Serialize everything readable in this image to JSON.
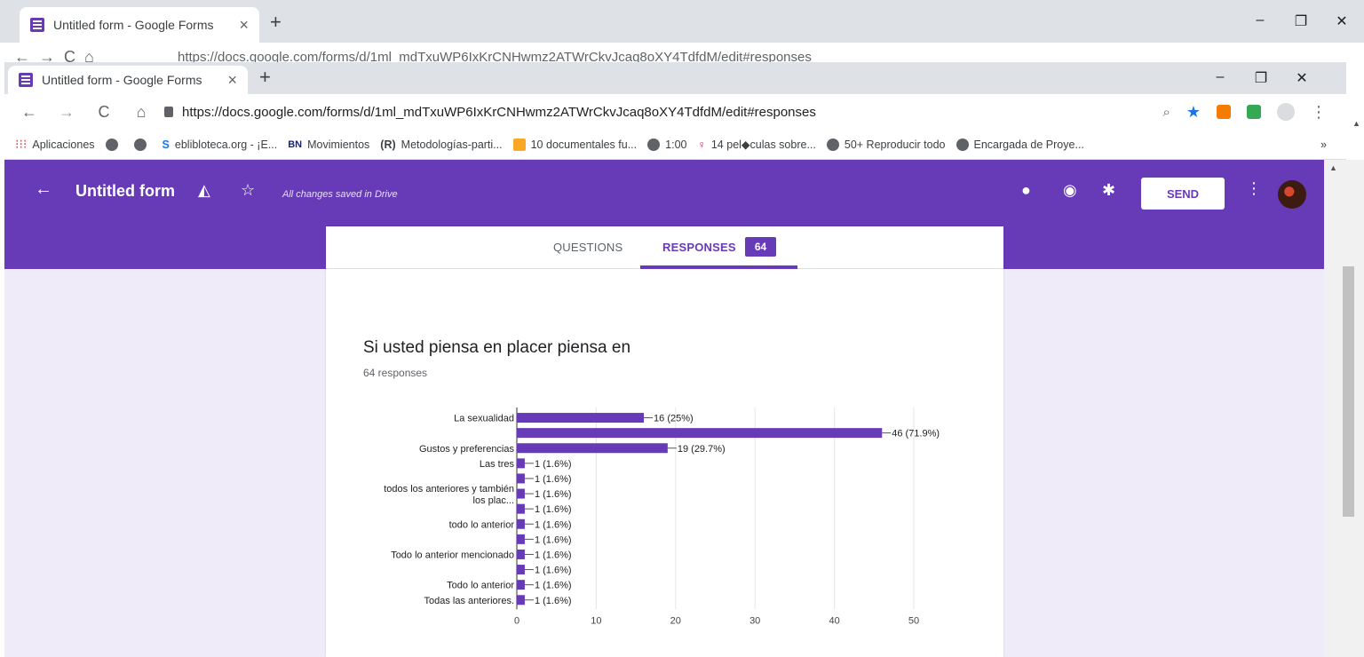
{
  "outer_browser": {
    "tab_title": "Untitled form - Google Forms",
    "url_partial": "https://docs.google.com/forms/d/1ml_mdTxuWP6IxKrCNHwmz2ATWrCkvJcaq8oXY4TdfdM/edit#responses"
  },
  "browser": {
    "tab_title": "Untitled form - Google Forms",
    "url": "https://docs.google.com/forms/d/1ml_mdTxuWP6IxKrCNHwmz2ATWrCkvJcaq8oXY4TdfdM/edit#responses",
    "bookmarks": [
      "Aplicaciones",
      "",
      "",
      "eblibloteca.org - ¡E...",
      "Movimientos",
      "Metodologías-parti...",
      "10 documentales fu...",
      "1:00",
      "14 pel◆culas sobre...",
      "50+ Reproducir todo",
      "Encargada de Proye..."
    ],
    "bookmarks_overflow": "»",
    "colors": {
      "tabbar": "#dee1e6",
      "bookmark_star": "#1a73e8"
    }
  },
  "forms": {
    "title": "Untitled form",
    "saved_status": "All changes saved in Drive",
    "send_label": "SEND",
    "tab_questions": "QUESTIONS",
    "tab_responses": "RESPONSES",
    "responses_count": "64",
    "accent": "#673ab7",
    "question_title": "Si usted piensa en placer piensa en",
    "responses_label": "64 responses"
  },
  "chart_data": {
    "type": "bar",
    "orientation": "horizontal",
    "categories": [
      "La sexualidad",
      "",
      "Gustos y preferencias",
      "Las tres",
      "",
      "todos los anteriores y también los plac...",
      "",
      "todo lo anterior",
      "",
      "Todo lo anterior mencionado",
      "",
      "Todo lo anterior",
      "Todas las anteriores."
    ],
    "values": [
      16,
      46,
      19,
      1,
      1,
      1,
      1,
      1,
      1,
      1,
      1,
      1,
      1
    ],
    "data_labels": [
      "16 (25%)",
      "46 (71.9%)",
      "19 (29.7%)",
      "1 (1.6%)",
      "1 (1.6%)",
      "1 (1.6%)",
      "1 (1.6%)",
      "1 (1.6%)",
      "1 (1.6%)",
      "1 (1.6%)",
      "1 (1.6%)",
      "1 (1.6%)",
      "1 (1.6%)"
    ],
    "xticks": [
      0,
      10,
      20,
      30,
      40,
      50
    ],
    "xlim": [
      0,
      50
    ],
    "grid": true,
    "color": "#673ab7"
  }
}
